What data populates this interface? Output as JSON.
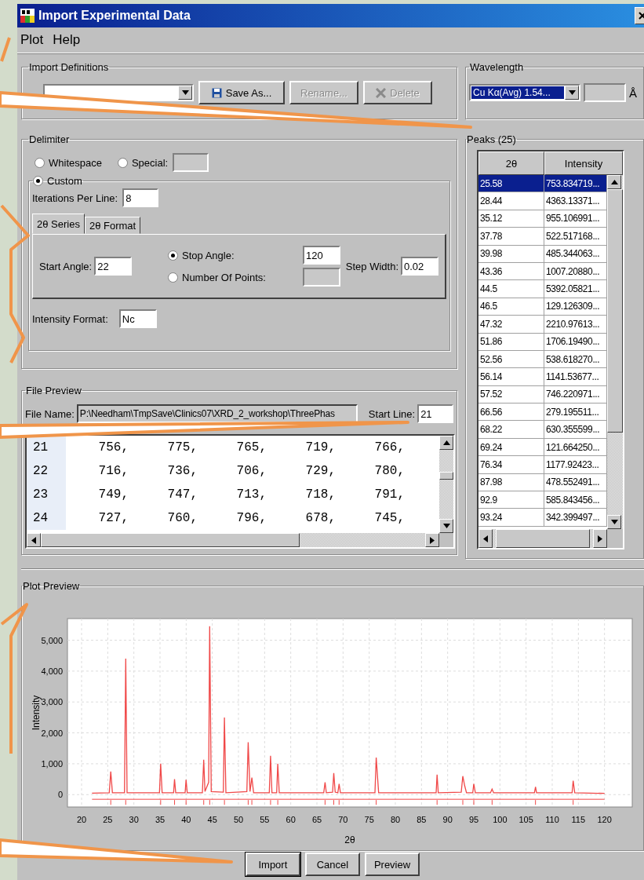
{
  "window": {
    "title": "Import Experimental Data"
  },
  "menu": [
    {
      "label": "Plot"
    },
    {
      "label": "Help"
    }
  ],
  "import_definitions": {
    "title": "Import Definitions",
    "buttons": [
      {
        "label": "Save As...",
        "disabled": false
      },
      {
        "label": "Rename...",
        "disabled": true
      },
      {
        "label": "Delete",
        "disabled": true
      }
    ]
  },
  "wavelength": {
    "title": "Wavelength",
    "value": "Cu Kα(Avg) 1.54...",
    "unit": "Å"
  },
  "delimiter": {
    "title": "Delimiter",
    "options": [
      {
        "label": "Whitespace",
        "selected": false,
        "kind": "plain"
      },
      {
        "label": "Special:",
        "selected": false,
        "kind": "field"
      }
    ],
    "custom": {
      "label": "Custom",
      "selected": true
    },
    "iterations": {
      "label": "Iterations Per Line:",
      "value": "8"
    },
    "tabs": [
      {
        "label": "2θ Series",
        "selected": true
      },
      {
        "label": "2θ Format",
        "selected": false
      }
    ],
    "start_angle": {
      "label": "Start Angle:",
      "value": "22"
    },
    "end_options": [
      {
        "label": "Stop Angle:",
        "selected": true,
        "value": "120"
      },
      {
        "label": "Number Of Points:",
        "selected": false
      }
    ],
    "step_width": {
      "label": "Step Width:",
      "value": "0.02"
    },
    "intensity_format": {
      "label": "Intensity Format:",
      "value": "Nc"
    }
  },
  "file_preview": {
    "title": "File Preview",
    "file_name_label": "File Name:",
    "file_name": "P:\\Needham\\TmpSave\\Clinics07\\XRD_2_workshop\\ThreePhas",
    "start_line_label": "Start Line:",
    "start_line": "21",
    "rows": [
      {
        "line": "21",
        "values": [
          "756,",
          "775,",
          "765,",
          "719,",
          "766,"
        ]
      },
      {
        "line": "22",
        "values": [
          "716,",
          "736,",
          "706,",
          "729,",
          "780,"
        ]
      },
      {
        "line": "23",
        "values": [
          "749,",
          "747,",
          "713,",
          "718,",
          "791,"
        ]
      },
      {
        "line": "24",
        "values": [
          "727,",
          "760,",
          "796,",
          "678,",
          "745,"
        ]
      }
    ]
  },
  "peaks": {
    "title": "Peaks (25)",
    "columns": [
      "2θ",
      "Intensity"
    ],
    "rows": [
      {
        "two_theta": "25.58",
        "intensity": "753.834719...",
        "selected": true
      },
      {
        "two_theta": "28.44",
        "intensity": "4363.13371...",
        "selected": false
      },
      {
        "two_theta": "35.12",
        "intensity": "955.106991...",
        "selected": false
      },
      {
        "two_theta": "37.78",
        "intensity": "522.517168...",
        "selected": false
      },
      {
        "two_theta": "39.98",
        "intensity": "485.344063...",
        "selected": false
      },
      {
        "two_theta": "43.36",
        "intensity": "1007.20880...",
        "selected": false
      },
      {
        "two_theta": "44.5",
        "intensity": "5392.05821...",
        "selected": false
      },
      {
        "two_theta": "46.5",
        "intensity": "129.126309...",
        "selected": false
      },
      {
        "two_theta": "47.32",
        "intensity": "2210.97613...",
        "selected": false
      },
      {
        "two_theta": "51.86",
        "intensity": "1706.19490...",
        "selected": false
      },
      {
        "two_theta": "52.56",
        "intensity": "538.618270...",
        "selected": false
      },
      {
        "two_theta": "56.14",
        "intensity": "1141.53677...",
        "selected": false
      },
      {
        "two_theta": "57.52",
        "intensity": "746.220971...",
        "selected": false
      },
      {
        "two_theta": "66.56",
        "intensity": "279.195511...",
        "selected": false
      },
      {
        "two_theta": "68.22",
        "intensity": "630.355599...",
        "selected": false
      },
      {
        "two_theta": "69.24",
        "intensity": "121.664250...",
        "selected": false
      },
      {
        "two_theta": "76.34",
        "intensity": "1177.92423...",
        "selected": false
      },
      {
        "two_theta": "87.98",
        "intensity": "478.552491...",
        "selected": false
      },
      {
        "two_theta": "92.9",
        "intensity": "585.843456...",
        "selected": false
      },
      {
        "two_theta": "93.24",
        "intensity": "342.399497...",
        "selected": false
      }
    ]
  },
  "plot_preview": {
    "title": "Plot Preview",
    "chart_data": {
      "type": "line",
      "grid": true,
      "xlabel": "2θ",
      "ylabel": "Intensity",
      "xlim": [
        17.3,
        125.3
      ],
      "ylim": [
        -400,
        5700
      ],
      "xticks": [
        20,
        25,
        30,
        35,
        40,
        45,
        50,
        55,
        60,
        65,
        70,
        75,
        80,
        85,
        90,
        95,
        100,
        105,
        110,
        115,
        120
      ],
      "yticks": [
        {
          "value": 0,
          "label": "0"
        },
        {
          "value": 1000,
          "label": "1,000"
        },
        {
          "value": 2000,
          "label": "2,000"
        },
        {
          "value": 3000,
          "label": "3,000"
        },
        {
          "value": 4000,
          "label": "4,000"
        },
        {
          "value": 5000,
          "label": "5,000"
        }
      ],
      "x": [
        22,
        25.3,
        25.58,
        25.9,
        28.2,
        28.44,
        28.7,
        34.9,
        35.12,
        35.4,
        37.6,
        37.78,
        38.0,
        39.8,
        39.98,
        40.2,
        43.1,
        43.36,
        43.6,
        44.3,
        44.5,
        44.8,
        47.1,
        47.32,
        47.6,
        51.6,
        51.86,
        52.2,
        52.56,
        52.9,
        55.9,
        56.14,
        56.4,
        57.3,
        57.52,
        57.8,
        66.3,
        66.56,
        66.8,
        68.0,
        68.22,
        68.5,
        69.0,
        69.24,
        69.5,
        76.1,
        76.34,
        76.8,
        87.8,
        87.98,
        88.2,
        92.6,
        92.9,
        93.24,
        93.6,
        94.8,
        95.0,
        95.3,
        98.2,
        98.5,
        98.8,
        106.6,
        106.8,
        107.0,
        113.8,
        114.0,
        114.3,
        120
      ],
      "ref_lines": [
        {
          "axis": "y",
          "value": -150,
          "color": "#f04848"
        }
      ],
      "series": [
        {
          "color": "#f04848",
          "values": [
            50,
            60,
            750,
            60,
            60,
            4400,
            60,
            60,
            1000,
            60,
            60,
            500,
            60,
            60,
            480,
            60,
            60,
            1130,
            100,
            400,
            5450,
            100,
            80,
            2500,
            60,
            100,
            1700,
            100,
            550,
            60,
            60,
            1260,
            60,
            60,
            1000,
            60,
            60,
            400,
            60,
            80,
            700,
            80,
            60,
            350,
            60,
            60,
            1200,
            60,
            60,
            650,
            60,
            80,
            600,
            300,
            60,
            60,
            350,
            60,
            60,
            180,
            60,
            60,
            250,
            60,
            60,
            450,
            60,
            40
          ]
        }
      ]
    }
  },
  "buttons": [
    {
      "label": "Import",
      "default": true
    },
    {
      "label": "Cancel",
      "default": false
    },
    {
      "label": "Preview",
      "default": false
    }
  ]
}
